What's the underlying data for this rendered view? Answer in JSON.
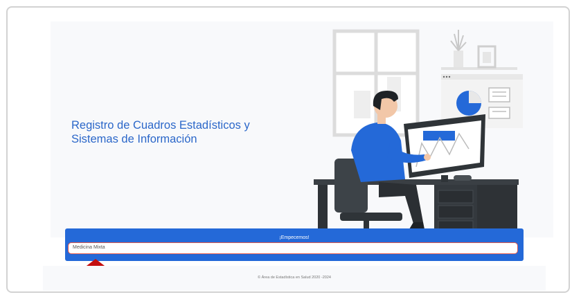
{
  "hero": {
    "title_line1": "Registro de Cuadros Estadísticos y",
    "title_line2": "Sistemas de Información"
  },
  "form": {
    "banner_label": "¡Empecemos!",
    "selected_value": "Medicina Mixta"
  },
  "footer": {
    "text": "© Área de Estadística en Salud 2020 -2024"
  },
  "colors": {
    "brand_blue": "#2469d8",
    "title_blue": "#2b67c9",
    "select_border": "#e0574b",
    "arrow_red": "#c40f0f",
    "hero_background": "#f8f9fb"
  },
  "icons": {
    "pointer": "arrow-up-icon",
    "illustration": "person-at-computer-illustration"
  }
}
